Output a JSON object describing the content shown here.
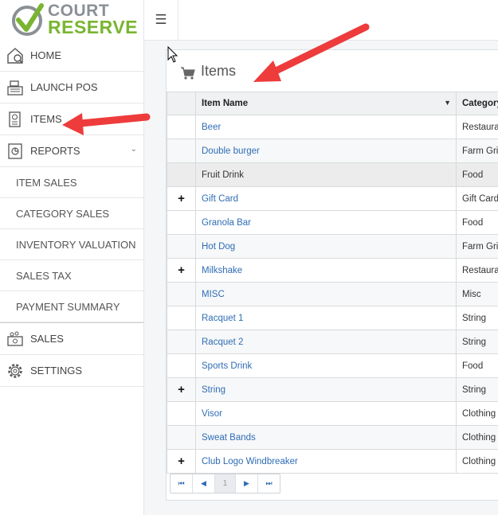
{
  "brand": {
    "line1": "COURT",
    "line2": "RESERVE",
    "accent": "#79b531",
    "gray": "#8b9095"
  },
  "topbar": {
    "menu_icon": "☰"
  },
  "sidebar": {
    "items": [
      {
        "label": "HOME",
        "icon": "home-icon"
      },
      {
        "label": "LAUNCH POS",
        "icon": "cash-register-icon"
      },
      {
        "label": "ITEMS",
        "icon": "receipt-icon",
        "chevron": "‹"
      },
      {
        "label": "REPORTS",
        "icon": "report-icon",
        "chevron": "⌄"
      },
      {
        "label": "SALES",
        "icon": "cash-icon"
      },
      {
        "label": "SETTINGS",
        "icon": "gear-icon"
      }
    ],
    "report_sub": [
      "ITEM SALES",
      "CATEGORY SALES",
      "INVENTORY VALUATION",
      "SALES TAX",
      "PAYMENT SUMMARY"
    ]
  },
  "panel": {
    "title": "Items"
  },
  "grid": {
    "columns": [
      "Item Name",
      "Category"
    ],
    "filter_icon": "▼",
    "rows": [
      {
        "expand": "",
        "name": "Beer",
        "category": "Restaurant"
      },
      {
        "expand": "",
        "name": "Double burger",
        "category": "Farm Grill"
      },
      {
        "expand": "",
        "name": "Fruit Drink",
        "category": "Food"
      },
      {
        "expand": "+",
        "name": "Gift Card",
        "category": "Gift Card"
      },
      {
        "expand": "",
        "name": "Granola Bar",
        "category": "Food"
      },
      {
        "expand": "",
        "name": "Hot Dog",
        "category": "Farm Grill"
      },
      {
        "expand": "+",
        "name": "Milkshake",
        "category": "Restaurant"
      },
      {
        "expand": "",
        "name": "MISC",
        "category": "Misc"
      },
      {
        "expand": "",
        "name": "Racquet 1",
        "category": "String"
      },
      {
        "expand": "",
        "name": "Racquet 2",
        "category": "String"
      },
      {
        "expand": "",
        "name": "Sports Drink",
        "category": "Food"
      },
      {
        "expand": "+",
        "name": "String",
        "category": "String"
      },
      {
        "expand": "",
        "name": "Visor",
        "category": "Clothing"
      },
      {
        "expand": "",
        "name": "Sweat Bands",
        "category": "Clothing"
      },
      {
        "expand": "+",
        "name": "Club Logo Windbreaker",
        "category": "Clothing"
      }
    ]
  },
  "pager": {
    "first": "⏮",
    "prev": "◀",
    "page": "1",
    "next": "▶",
    "last": "⏭"
  },
  "annotation_color": "#ee3b3b"
}
